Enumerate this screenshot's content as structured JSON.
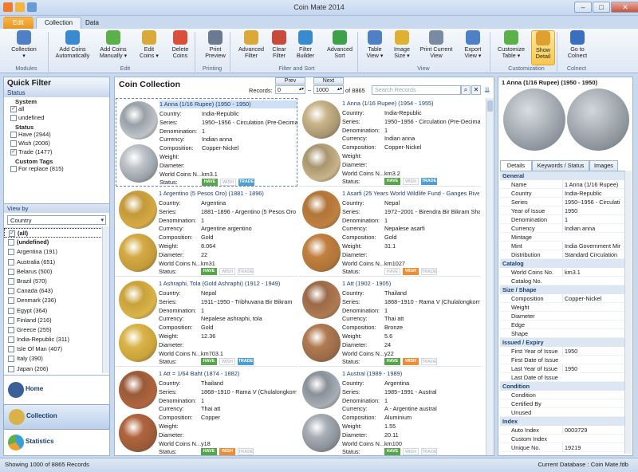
{
  "window": {
    "title": "Coin Mate 2014"
  },
  "tabs": [
    "Edit",
    "Collection",
    "Data"
  ],
  "ribbon": {
    "buttons": [
      {
        "label": "Collection",
        "sub": "▾"
      },
      {
        "label": "Add Coins",
        "sub": "Automatically"
      },
      {
        "label": "Add Coins",
        "sub": "Manually ▾"
      },
      {
        "label": "Edit",
        "sub": "Coins ▾"
      },
      {
        "label": "Delete",
        "sub": "Coins"
      },
      {
        "label": "Print",
        "sub": "Preview"
      },
      {
        "label": "Advanced",
        "sub": "Filter"
      },
      {
        "label": "Clear",
        "sub": "Filter"
      },
      {
        "label": "Filter",
        "sub": "Builder"
      },
      {
        "label": "Advanced",
        "sub": "Sort"
      },
      {
        "label": "Table",
        "sub": "View ▾"
      },
      {
        "label": "Image",
        "sub": "Size ▾"
      },
      {
        "label": "Print Current",
        "sub": "View"
      },
      {
        "label": "Export",
        "sub": "View ▾"
      },
      {
        "label": "Customize",
        "sub": "Table ▾"
      },
      {
        "label": "Show",
        "sub": "Detail"
      },
      {
        "label": "Go to",
        "sub": "Colnect"
      }
    ],
    "groups": [
      "Modules",
      "Edit",
      "Printing",
      "Filter and Sort",
      "View",
      "Customization",
      "Colnect"
    ]
  },
  "quick_filter": {
    "title": "Quick Filter",
    "section": "Status",
    "system_label": "System",
    "system": [
      {
        "label": "all",
        "checked": true
      },
      {
        "label": "undefined",
        "checked": false
      }
    ],
    "status_label": "Status",
    "statuses": [
      {
        "label": "Have (2944)"
      },
      {
        "label": "Wish (2006)"
      },
      {
        "label": "Trade (1477)",
        "checked": true
      }
    ],
    "tags_label": "Custom Tags",
    "tags": [
      {
        "label": "For replace (815)"
      }
    ]
  },
  "view_by": {
    "title": "View by",
    "selected": "Country",
    "items": [
      "(all)",
      "(undefined)",
      "Argentina (191)",
      "Australia (651)",
      "Belarus (500)",
      "Brazil (570)",
      "Canada (643)",
      "Denmark (236)",
      "Egypt (364)",
      "Finland (216)",
      "Greece (255)",
      "India-Republic (311)",
      "Isle Of Man (407)",
      "Italy (390)",
      "Japan (206)"
    ]
  },
  "nav": [
    {
      "label": "Home"
    },
    {
      "label": "Collection"
    },
    {
      "label": "Statistics"
    }
  ],
  "collection": {
    "title": "Coin Collection",
    "records_label": "Records:",
    "prev_label": "Prev",
    "next_label": "Next",
    "from": "0",
    "dash": "–",
    "to": "1000",
    "of_label": "of 8865",
    "search_placeholder": "Search Records",
    "field_labels": [
      "Country:",
      "Series:",
      "Denomination:",
      "Currency:",
      "Composition:",
      "Weight:",
      "Diameter:",
      "World Coins N...",
      "Status:"
    ],
    "coins": [
      {
        "title": "1 Anna (1/16 Rupee)  (1950 - 1950)",
        "country": "India-Republic",
        "series": "1950~1956 - Circulation (Pre-Decima",
        "denom": "1",
        "currency": "Indian anna",
        "comp": "Copper-Nickel",
        "weight": "",
        "diameter": "",
        "wcn": "km3.1",
        "status": [
          1,
          0,
          1
        ]
      },
      {
        "title": "1 Anna (1/16 Rupee)  (1954 - 1955)",
        "country": "India-Republic",
        "series": "1950~1956 - Circulation (Pre-Decima",
        "denom": "1",
        "currency": "Indian anna",
        "comp": "Copper-Nickel",
        "weight": "",
        "diameter": "",
        "wcn": "km3.2",
        "status": [
          1,
          0,
          1
        ]
      },
      {
        "title": "1 Argentino (5 Pesos Oro)  (1881 - 1896)",
        "country": "Argentina",
        "series": "1881~1896 - Argentino (5 Pesos Oro",
        "denom": "1",
        "currency": "Argentine argentino",
        "comp": "Gold",
        "weight": "8.064",
        "diameter": "22",
        "wcn": "km31",
        "status": [
          1,
          0,
          0
        ]
      },
      {
        "title": "1 Asarfi (25 Years World Wildlife Fund - Ganges Rive",
        "country": "Nepal",
        "series": "1972~2001 - Birendra Bir Bikram Sha",
        "denom": "1",
        "currency": "Nepalese asarfi",
        "comp": "Gold",
        "weight": "31.1",
        "diameter": "",
        "wcn": "km1027",
        "status": [
          0,
          1,
          0
        ]
      },
      {
        "title": "1 Ashraphi, Tola (Gold Ashraphi)  (1912 - 1949)",
        "country": "Nepal",
        "series": "1911~1950 - Tribhuvana Bir Bikram",
        "denom": "1",
        "currency": "Nepalese ashraphi, tola",
        "comp": "Gold",
        "weight": "12.36",
        "diameter": "",
        "wcn": "km703.1",
        "status": [
          1,
          0,
          1
        ]
      },
      {
        "title": "1 Att  (1902 - 1905)",
        "country": "Thailand",
        "series": "1868~1910 - Rama V (Chulalongkorn",
        "denom": "1",
        "currency": "Thai att",
        "comp": "Bronze",
        "weight": "5.6",
        "diameter": "24",
        "wcn": "y22",
        "status": [
          1,
          1,
          0
        ]
      },
      {
        "title": "1 Att = 1/64 Baht  (1874 - 1882)",
        "country": "Thailand",
        "series": "1868~1910 - Rama V (Chulalongkorn",
        "denom": "1",
        "currency": "Thai att",
        "comp": "Copper",
        "weight": "",
        "diameter": "",
        "wcn": "y18",
        "status": [
          1,
          1,
          0
        ]
      },
      {
        "title": "1 Austral  (1989 - 1989)",
        "country": "Argentina",
        "series": "1985~1991 - Austral",
        "denom": "1",
        "currency": "A - Argentine austral",
        "comp": "Aluminium",
        "weight": "1.55",
        "diameter": "20.11",
        "wcn": "km100",
        "status": [
          1,
          0,
          0
        ]
      }
    ],
    "tag_labels": [
      "HAVE",
      "WISH",
      "TRADE"
    ]
  },
  "detail": {
    "title": "1 Anna (1/16 Rupee)  (1950 - 1950)",
    "tabs": [
      "Details",
      "Keywords / Status",
      "Images"
    ],
    "sections": [
      {
        "name": "General",
        "rows": [
          [
            "Name",
            "1 Anna (1/16 Rupee)"
          ],
          [
            "Country",
            "India-Republic"
          ],
          [
            "Series",
            "1950~1956 - Circulati"
          ],
          [
            "Year of Issue",
            "1950"
          ],
          [
            "Denomination",
            "1"
          ],
          [
            "Currency",
            "Indian anna"
          ],
          [
            "Mintage",
            ""
          ],
          [
            "Mint",
            "India Government Mir"
          ],
          [
            "Distribution",
            "Standard Circulation"
          ]
        ]
      },
      {
        "name": "Catalog",
        "rows": [
          [
            "World Coins No.",
            "km3.1"
          ],
          [
            "Catalog No.",
            ""
          ]
        ]
      },
      {
        "name": "Size / Shape",
        "rows": [
          [
            "Composition",
            "Copper-Nickel"
          ],
          [
            "Weight",
            ""
          ],
          [
            "Diameter",
            ""
          ],
          [
            "Edge",
            ""
          ],
          [
            "Shape",
            ""
          ]
        ]
      },
      {
        "name": "Issued / Expiry",
        "rows": [
          [
            "First Year of Issue",
            "1950"
          ],
          [
            "First Date of Issue",
            ""
          ],
          [
            "Last Year of Issue",
            "1950"
          ],
          [
            "Last Date of Issue",
            ""
          ]
        ]
      },
      {
        "name": "Condition",
        "rows": [
          [
            "Condition",
            ""
          ],
          [
            "Certified By",
            ""
          ],
          [
            "Unused",
            ""
          ]
        ]
      },
      {
        "name": "Index",
        "rows": [
          [
            "Auto Index",
            "0003729"
          ],
          [
            "Custom Index",
            ""
          ],
          [
            "Unique No.",
            "19219"
          ]
        ]
      }
    ]
  },
  "statusbar": {
    "left": "Showing 1000 of 8865 Records",
    "right": "Current Database :  Coin Mate.fdb"
  },
  "colors": {
    "accent": "#2a4d8f",
    "have": "#57a64a",
    "wish": "#ef8c32",
    "trade": "#4c9fd6",
    "selected_button": "#f9c74f"
  }
}
